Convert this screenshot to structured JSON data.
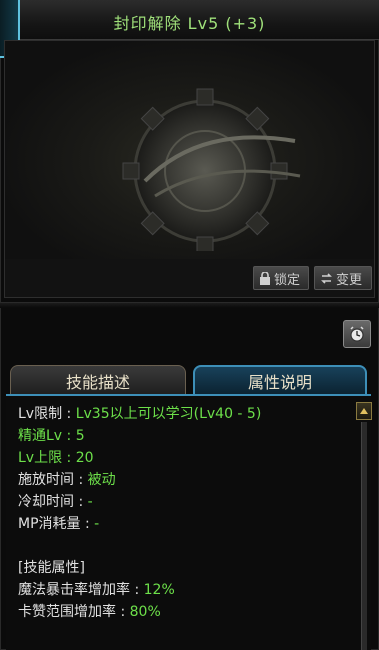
{
  "title": "封印解除 Lv5 (+3)",
  "preview": {
    "lock_label": "锁定",
    "change_label": "变更"
  },
  "tabs": {
    "description": "技能描述",
    "attributes": "属性说明"
  },
  "attributes": {
    "lv_limit_label": "Lv限制",
    "lv_limit_value": "Lv35以上可以学习(Lv40 - 5)",
    "mastery_label": "精通Lv",
    "mastery_value": "5",
    "lv_cap_label": "Lv上限",
    "lv_cap_value": "20",
    "cast_time_label": "施放时间",
    "cast_time_value": "被动",
    "cooldown_label": "冷却时间",
    "cooldown_value": "-",
    "mp_label": "MP消耗量",
    "mp_value": "-",
    "section_header": "[技能属性]",
    "crit_label": "魔法暴击率增加率",
    "crit_value": "12%",
    "card_label": "卡赞范围增加率",
    "card_value": "80%"
  },
  "colors": {
    "accent_green": "#6de04a",
    "tab_active_border": "#3d8fb8",
    "title_green": "#9fe07a"
  }
}
